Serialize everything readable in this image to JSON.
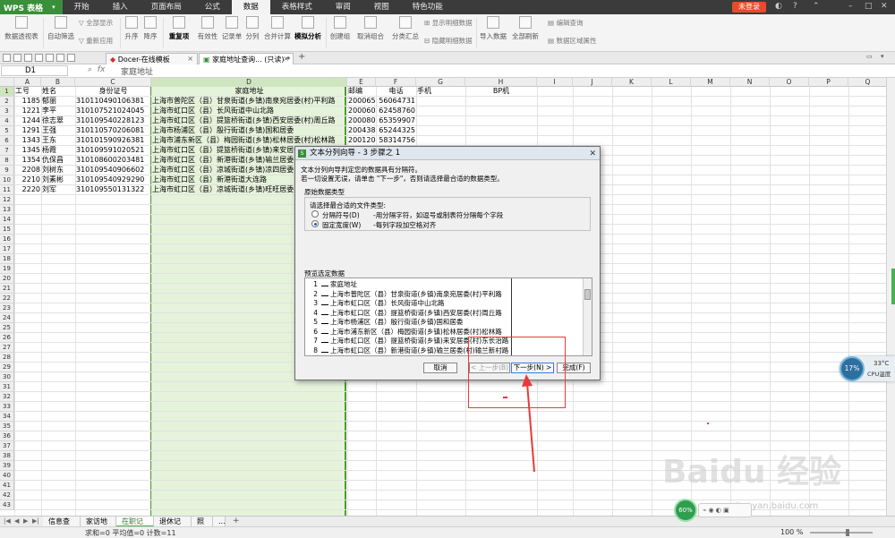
{
  "app": {
    "name": "WPS 表格",
    "login": "未登录"
  },
  "menu": [
    "开始",
    "插入",
    "页面布局",
    "公式",
    "数据",
    "表格样式",
    "审阅",
    "视图",
    "特色功能"
  ],
  "menu_active_index": 4,
  "ribbon": {
    "groups": [
      "数据透视表",
      "自动筛选",
      "全部显示",
      "重新应用",
      "升序",
      "降序",
      "重复项",
      "有效性",
      "记录单",
      "分列",
      "合并计算",
      "模拟分析",
      "创建组",
      "取消组合",
      "分类汇总",
      "显示明细数据",
      "隐藏明细数据",
      "导入数据",
      "全部刷新",
      "编辑查询",
      "数据区域属性"
    ]
  },
  "tabs": [
    {
      "label": "Docer-在线模板"
    },
    {
      "label": "家庭地址查询... (只读) *"
    }
  ],
  "formula_bar": {
    "name_box": "D1",
    "content": "家庭地址"
  },
  "columns": [
    "A",
    "B",
    "C",
    "D",
    "E",
    "F",
    "G",
    "H",
    "I",
    "J",
    "K",
    "L",
    "M",
    "N",
    "O",
    "P",
    "Q"
  ],
  "rows_count": 43,
  "sheet": {
    "headers": {
      "A": "工号",
      "B": "姓名",
      "C": "身份证号",
      "D": "家庭地址",
      "E": "邮编",
      "F": "电话",
      "G": "手机",
      "H": "BP机"
    },
    "data": [
      {
        "A": "1185",
        "B": "郁丽",
        "C": "310110490106381",
        "D": "上海市普陀区（县）甘泉街道(乡镇)南泉宛居委(村)平利路",
        "E": "200065",
        "F": "56064731"
      },
      {
        "A": "1221",
        "B": "李平",
        "C": "310107521024045",
        "D": "上海市虹口区（县）长风街道中山北路",
        "E": "200060",
        "F": "62458760"
      },
      {
        "A": "1244",
        "B": "徐志翠",
        "C": "310109540228123",
        "D": "上海市虹口区（县）提篮桥街道(乡镇)西安居委(村)周丘路",
        "E": "200080",
        "F": "65359907"
      },
      {
        "A": "1291",
        "B": "王强",
        "C": "310110570206081",
        "D": "上海市杨浦区（县）殷行街道(乡镇)国和居委",
        "E": "200438",
        "F": "65244325"
      },
      {
        "A": "1343",
        "B": "王东",
        "C": "310101590926381",
        "D": "上海市浦东新区（县）梅园街道(乡镇)松林居委(村)松林路",
        "E": "200120",
        "F": "58314756"
      },
      {
        "A": "1345",
        "B": "杨霞",
        "C": "310109591020521",
        "D": "上海市虹口区（县）提篮桥街道(乡镇)来安居委(村)东长治路",
        "E": "",
        "F": ""
      },
      {
        "A": "1354",
        "B": "仇保昌",
        "C": "310108600203481",
        "D": "上海市虹口区（县）新港街道(乡镇)输兰居委(村)输兰新村路",
        "E": "",
        "F": ""
      },
      {
        "A": "2208",
        "B": "刘树东",
        "C": "310109540906602",
        "D": "上海市虹口区（县）凉城街道(乡镇)凉四居委(村)凉城路",
        "E": "",
        "F": ""
      },
      {
        "A": "2210",
        "B": "刘素彬",
        "C": "310109540929290",
        "D": "上海市虹口区（县）新港街道大连路",
        "E": "",
        "F": ""
      },
      {
        "A": "2220",
        "B": "刘军",
        "C": "310109550131322",
        "D": "上海市虹口区（县）凉城街道(乡镇)旺旺居委(村)旺旺路",
        "E": "",
        "F": ""
      }
    ]
  },
  "dialog": {
    "title": "文本分列向导 - 3 步骤之 1",
    "intro1": "文本分列向导判定您的数据具有分隔符。",
    "intro2": "若一切设置无误，请单击 \"下一步\"，否则请选择最合适的数据类型。",
    "group_label": "原始数据类型",
    "prompt": "请选择最合适的文件类型:",
    "options": [
      {
        "label": "分隔符号(D)",
        "desc": "-用分隔字符，如逗号或制表符分隔每个字段",
        "selected": false
      },
      {
        "label": "固定宽度(W)",
        "desc": "-每列字段加空格对齐",
        "selected": true
      }
    ],
    "preview_label": "预览选定数据",
    "preview_rows": [
      "家庭地址",
      "上海市普陀区（县）甘泉街道(乡镇)南泉宛居委(村)平利路",
      "上海市虹口区（县）长风街道中山北路",
      "上海市虹口区（县）提篮桥街道(乡镇)西安居委(村)周丘路",
      "上海市杨浦区（县）殷行街道(乡镇)国和居委",
      "上海市浦东新区（县）梅园街道(乡镇)松林居委(村)松林路",
      "上海市虹口区（县）提篮桥街道(乡镇)来安居委(村)东长治路",
      "上海市虹口区（县）新港街道(乡镇)输兰居委(村)输兰新村路",
      "上海市虹口区（县）凉城街道(乡镇)凉四居委(村)凉城路"
    ],
    "buttons": {
      "cancel": "取消",
      "prev": "< 上一步(B)",
      "next": "下一步(N) >",
      "finish": "完成(F)"
    }
  },
  "sheet_tabs": [
    "信息查询",
    "家访地址",
    "在职记录",
    "退休记录",
    "照片",
    "..."
  ],
  "active_sheet_index": 2,
  "status": {
    "summary": "求和=0  平均值=0  计数=11",
    "zoom": "100 %"
  },
  "widgets": {
    "cpu_percent": "17%",
    "cpu_temp": "33°C",
    "cpu_label": "CPU温度",
    "badge": "60%"
  },
  "watermark": {
    "main": "Baidu 经验",
    "sub": "jingyan.baidu.com"
  },
  "colors": {
    "accent_green": "#4caf50",
    "annotation_red": "#e83a3a",
    "login_red": "#e84b2c"
  }
}
